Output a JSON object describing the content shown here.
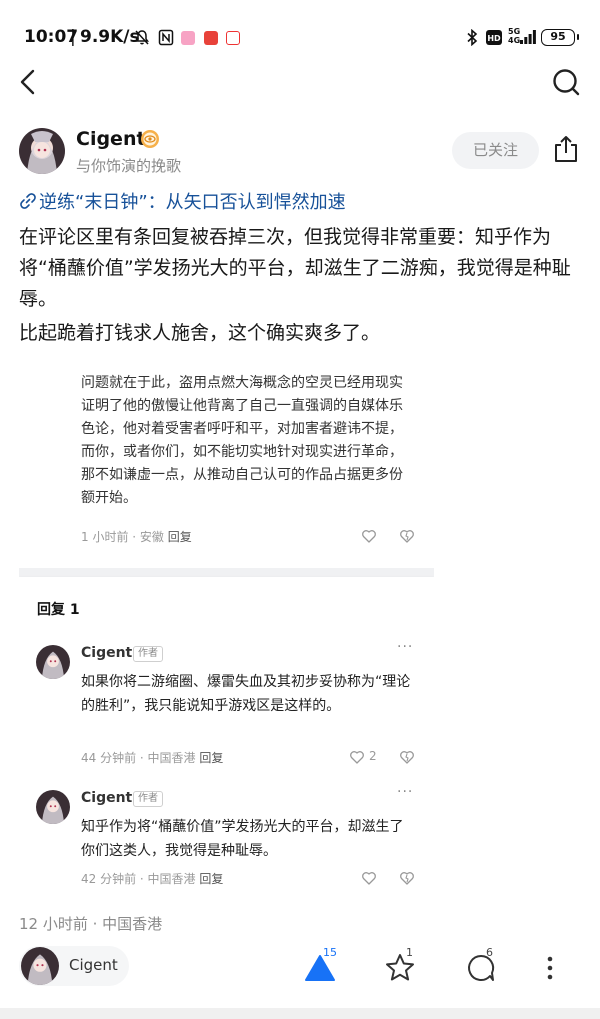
{
  "status_bar": {
    "time": "10:07",
    "separator": "|",
    "net_speed": "9.9K/s",
    "network_label": "5G",
    "network_sub": "4G",
    "hd_label": "HD",
    "battery": "95"
  },
  "author": {
    "name": "Cigent",
    "subtitle": "与你饰演的挽歌",
    "follow_label": "已关注"
  },
  "post": {
    "link_title": "逆练“末日钟”：从矢口否认到悍然加速",
    "paragraphs": [
      "在评论区里有条回复被吞掉三次，但我觉得非常重要：知乎作为将“桶蘸价值”学发扬光大的平台，却滋生了二游痴，我觉得是种耻辱。",
      "比起跪着打钱求人施舍，这个确实爽多了。"
    ],
    "meta": "12 小时前 · 中国香港"
  },
  "screenshot": {
    "quote": "问题就在于此，盗用点燃大海概念的空灵已经用现实证明了他的傲慢让他背离了自己一直强调的自媒体乐色论，他对着受害者呼吁和平，对加害者避讳不提，而你，或者你们，如不能切实地针对现实进行革命，那不如谦虚一点，从推动自己认可的作品占据更多份额开始。",
    "quote_meta": "1 小时前 · 安徽",
    "quote_reply": "回复",
    "reply_section_title": "回复 1",
    "replies": [
      {
        "name": "Cigent",
        "tag": "作者",
        "more": "···",
        "text": "如果你将二游缩圈、爆雷失血及其初步妥协称为“理论的胜利”，我只能说知乎游戏区是这样的。",
        "meta": "44 分钟前 · 中国香港",
        "reply_label": "回复",
        "likes": "2"
      },
      {
        "name": "Cigent",
        "tag": "作者",
        "more": "···",
        "text": "知乎作为将“桶蘸价值”学发扬光大的平台，却滋生了你们这类人，我觉得是种耻辱。",
        "meta": "42 分钟前 · 中国香港",
        "reply_label": "回复",
        "likes": ""
      }
    ]
  },
  "bottom_bar": {
    "user_name": "Cigent",
    "upvote_count": "15",
    "favorite_count": "1",
    "comment_count": "6"
  },
  "colors": {
    "link": "#175199",
    "accent": "#1772f6",
    "muted": "#8a8a8a"
  },
  "icons": [
    "back-arrow-icon",
    "search-icon",
    "verified-badge-icon",
    "share-icon",
    "link-icon",
    "heart-icon",
    "dislike-heart-icon",
    "upvote-triangle-icon",
    "star-icon",
    "comment-icon",
    "more-vertical-icon"
  ]
}
